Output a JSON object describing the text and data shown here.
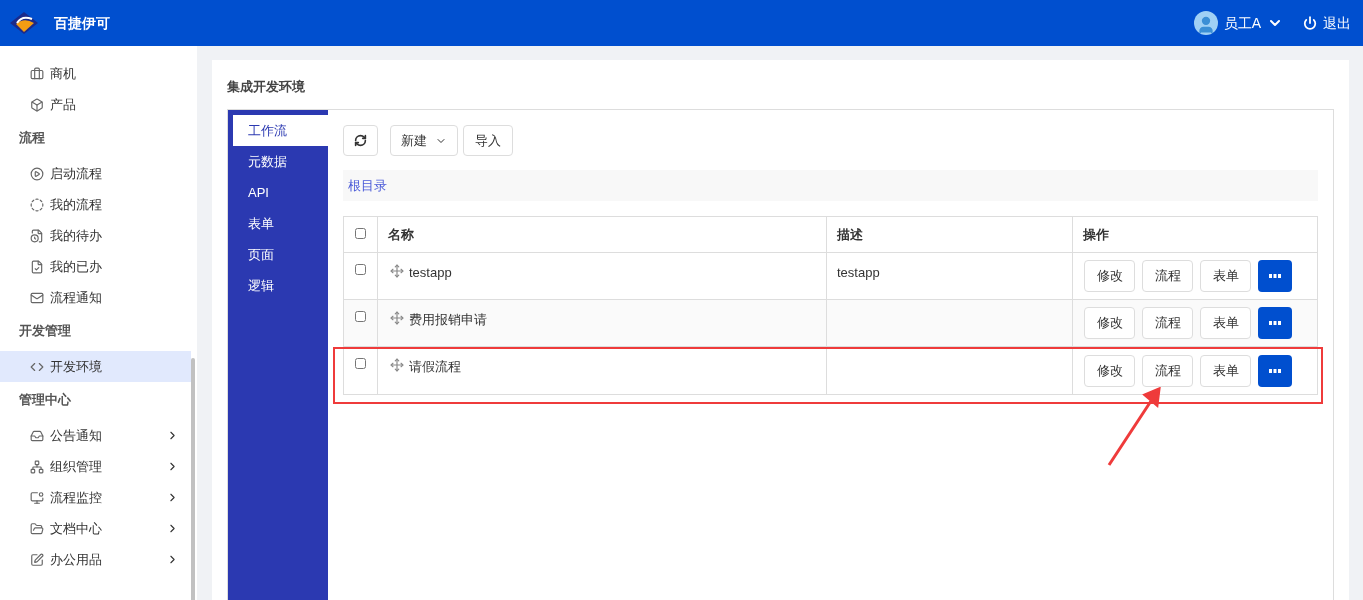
{
  "header": {
    "brand": "百捷伊可",
    "user": "员工A",
    "logout": "退出"
  },
  "sidebar": {
    "sections": [
      {
        "items": [
          {
            "label": "商机",
            "selected": false,
            "has_submenu": false
          },
          {
            "label": "产品",
            "selected": false,
            "has_submenu": false
          }
        ]
      },
      {
        "title": "流程",
        "items": [
          {
            "label": "启动流程",
            "selected": false,
            "has_submenu": false
          },
          {
            "label": "我的流程",
            "selected": false,
            "has_submenu": false
          },
          {
            "label": "我的待办",
            "selected": false,
            "has_submenu": false
          },
          {
            "label": "我的已办",
            "selected": false,
            "has_submenu": false
          },
          {
            "label": "流程通知",
            "selected": false,
            "has_submenu": false
          }
        ]
      },
      {
        "title": "开发管理",
        "items": [
          {
            "label": "开发环境",
            "selected": true,
            "has_submenu": false
          }
        ]
      },
      {
        "title": "管理中心",
        "items": [
          {
            "label": "公告通知",
            "selected": false,
            "has_submenu": true
          },
          {
            "label": "组织管理",
            "selected": false,
            "has_submenu": true
          },
          {
            "label": "流程监控",
            "selected": false,
            "has_submenu": true
          },
          {
            "label": "文档中心",
            "selected": false,
            "has_submenu": true
          },
          {
            "label": "办公用品",
            "selected": false,
            "has_submenu": true
          }
        ]
      }
    ]
  },
  "page": {
    "title": "集成开发环境",
    "tabs": [
      {
        "label": "工作流",
        "selected": true
      },
      {
        "label": "元数据",
        "selected": false
      },
      {
        "label": "API",
        "selected": false
      },
      {
        "label": "表单",
        "selected": false
      },
      {
        "label": "页面",
        "selected": false
      },
      {
        "label": "逻辑",
        "selected": false
      }
    ],
    "toolbar": {
      "new": "新建",
      "import": "导入"
    },
    "breadcrumb": "根目录",
    "table": {
      "columns": [
        "名称",
        "描述",
        "操作"
      ],
      "header_checked": false,
      "rows": [
        {
          "checked": false,
          "name": "testapp",
          "description": "testapp",
          "actions": [
            "修改",
            "流程",
            "表单"
          ],
          "highlighted": false
        },
        {
          "checked": false,
          "name": "费用报销申请",
          "description": "",
          "actions": [
            "修改",
            "流程",
            "表单"
          ],
          "highlighted": false
        },
        {
          "checked": false,
          "name": "请假流程",
          "description": "",
          "actions": [
            "修改",
            "流程",
            "表单"
          ],
          "highlighted": true
        }
      ]
    }
  }
}
